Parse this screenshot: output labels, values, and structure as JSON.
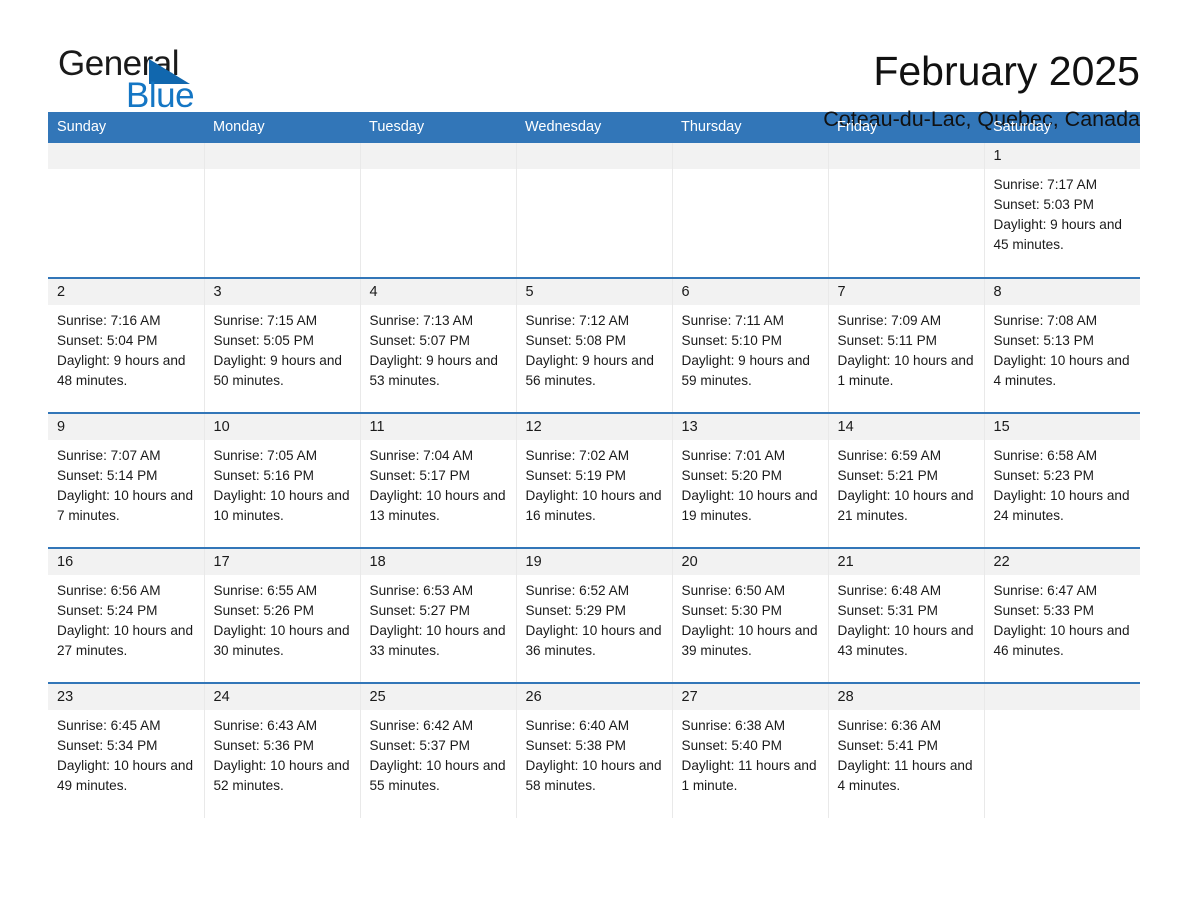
{
  "logo": {
    "word_one": "General",
    "word_two": "Blue",
    "triangle_color": "#1167ae",
    "blue_color": "#1476c4"
  },
  "header": {
    "month_title": "February 2025",
    "location": "Coteau-du-Lac, Quebec, Canada",
    "header_bg": "#3276b8",
    "daynum_bg": "#f2f2f2"
  },
  "weekdays": [
    "Sunday",
    "Monday",
    "Tuesday",
    "Wednesday",
    "Thursday",
    "Friday",
    "Saturday"
  ],
  "weeks": [
    [
      {
        "blank": true
      },
      {
        "blank": true
      },
      {
        "blank": true
      },
      {
        "blank": true
      },
      {
        "blank": true
      },
      {
        "blank": true
      },
      {
        "day": "1",
        "sunrise": "Sunrise: 7:17 AM",
        "sunset": "Sunset: 5:03 PM",
        "daylight": "Daylight: 9 hours and 45 minutes."
      }
    ],
    [
      {
        "day": "2",
        "sunrise": "Sunrise: 7:16 AM",
        "sunset": "Sunset: 5:04 PM",
        "daylight": "Daylight: 9 hours and 48 minutes."
      },
      {
        "day": "3",
        "sunrise": "Sunrise: 7:15 AM",
        "sunset": "Sunset: 5:05 PM",
        "daylight": "Daylight: 9 hours and 50 minutes."
      },
      {
        "day": "4",
        "sunrise": "Sunrise: 7:13 AM",
        "sunset": "Sunset: 5:07 PM",
        "daylight": "Daylight: 9 hours and 53 minutes."
      },
      {
        "day": "5",
        "sunrise": "Sunrise: 7:12 AM",
        "sunset": "Sunset: 5:08 PM",
        "daylight": "Daylight: 9 hours and 56 minutes."
      },
      {
        "day": "6",
        "sunrise": "Sunrise: 7:11 AM",
        "sunset": "Sunset: 5:10 PM",
        "daylight": "Daylight: 9 hours and 59 minutes."
      },
      {
        "day": "7",
        "sunrise": "Sunrise: 7:09 AM",
        "sunset": "Sunset: 5:11 PM",
        "daylight": "Daylight: 10 hours and 1 minute."
      },
      {
        "day": "8",
        "sunrise": "Sunrise: 7:08 AM",
        "sunset": "Sunset: 5:13 PM",
        "daylight": "Daylight: 10 hours and 4 minutes."
      }
    ],
    [
      {
        "day": "9",
        "sunrise": "Sunrise: 7:07 AM",
        "sunset": "Sunset: 5:14 PM",
        "daylight": "Daylight: 10 hours and 7 minutes."
      },
      {
        "day": "10",
        "sunrise": "Sunrise: 7:05 AM",
        "sunset": "Sunset: 5:16 PM",
        "daylight": "Daylight: 10 hours and 10 minutes."
      },
      {
        "day": "11",
        "sunrise": "Sunrise: 7:04 AM",
        "sunset": "Sunset: 5:17 PM",
        "daylight": "Daylight: 10 hours and 13 minutes."
      },
      {
        "day": "12",
        "sunrise": "Sunrise: 7:02 AM",
        "sunset": "Sunset: 5:19 PM",
        "daylight": "Daylight: 10 hours and 16 minutes."
      },
      {
        "day": "13",
        "sunrise": "Sunrise: 7:01 AM",
        "sunset": "Sunset: 5:20 PM",
        "daylight": "Daylight: 10 hours and 19 minutes."
      },
      {
        "day": "14",
        "sunrise": "Sunrise: 6:59 AM",
        "sunset": "Sunset: 5:21 PM",
        "daylight": "Daylight: 10 hours and 21 minutes."
      },
      {
        "day": "15",
        "sunrise": "Sunrise: 6:58 AM",
        "sunset": "Sunset: 5:23 PM",
        "daylight": "Daylight: 10 hours and 24 minutes."
      }
    ],
    [
      {
        "day": "16",
        "sunrise": "Sunrise: 6:56 AM",
        "sunset": "Sunset: 5:24 PM",
        "daylight": "Daylight: 10 hours and 27 minutes."
      },
      {
        "day": "17",
        "sunrise": "Sunrise: 6:55 AM",
        "sunset": "Sunset: 5:26 PM",
        "daylight": "Daylight: 10 hours and 30 minutes."
      },
      {
        "day": "18",
        "sunrise": "Sunrise: 6:53 AM",
        "sunset": "Sunset: 5:27 PM",
        "daylight": "Daylight: 10 hours and 33 minutes."
      },
      {
        "day": "19",
        "sunrise": "Sunrise: 6:52 AM",
        "sunset": "Sunset: 5:29 PM",
        "daylight": "Daylight: 10 hours and 36 minutes."
      },
      {
        "day": "20",
        "sunrise": "Sunrise: 6:50 AM",
        "sunset": "Sunset: 5:30 PM",
        "daylight": "Daylight: 10 hours and 39 minutes."
      },
      {
        "day": "21",
        "sunrise": "Sunrise: 6:48 AM",
        "sunset": "Sunset: 5:31 PM",
        "daylight": "Daylight: 10 hours and 43 minutes."
      },
      {
        "day": "22",
        "sunrise": "Sunrise: 6:47 AM",
        "sunset": "Sunset: 5:33 PM",
        "daylight": "Daylight: 10 hours and 46 minutes."
      }
    ],
    [
      {
        "day": "23",
        "sunrise": "Sunrise: 6:45 AM",
        "sunset": "Sunset: 5:34 PM",
        "daylight": "Daylight: 10 hours and 49 minutes."
      },
      {
        "day": "24",
        "sunrise": "Sunrise: 6:43 AM",
        "sunset": "Sunset: 5:36 PM",
        "daylight": "Daylight: 10 hours and 52 minutes."
      },
      {
        "day": "25",
        "sunrise": "Sunrise: 6:42 AM",
        "sunset": "Sunset: 5:37 PM",
        "daylight": "Daylight: 10 hours and 55 minutes."
      },
      {
        "day": "26",
        "sunrise": "Sunrise: 6:40 AM",
        "sunset": "Sunset: 5:38 PM",
        "daylight": "Daylight: 10 hours and 58 minutes."
      },
      {
        "day": "27",
        "sunrise": "Sunrise: 6:38 AM",
        "sunset": "Sunset: 5:40 PM",
        "daylight": "Daylight: 11 hours and 1 minute."
      },
      {
        "day": "28",
        "sunrise": "Sunrise: 6:36 AM",
        "sunset": "Sunset: 5:41 PM",
        "daylight": "Daylight: 11 hours and 4 minutes."
      },
      {
        "blank": true
      }
    ]
  ]
}
